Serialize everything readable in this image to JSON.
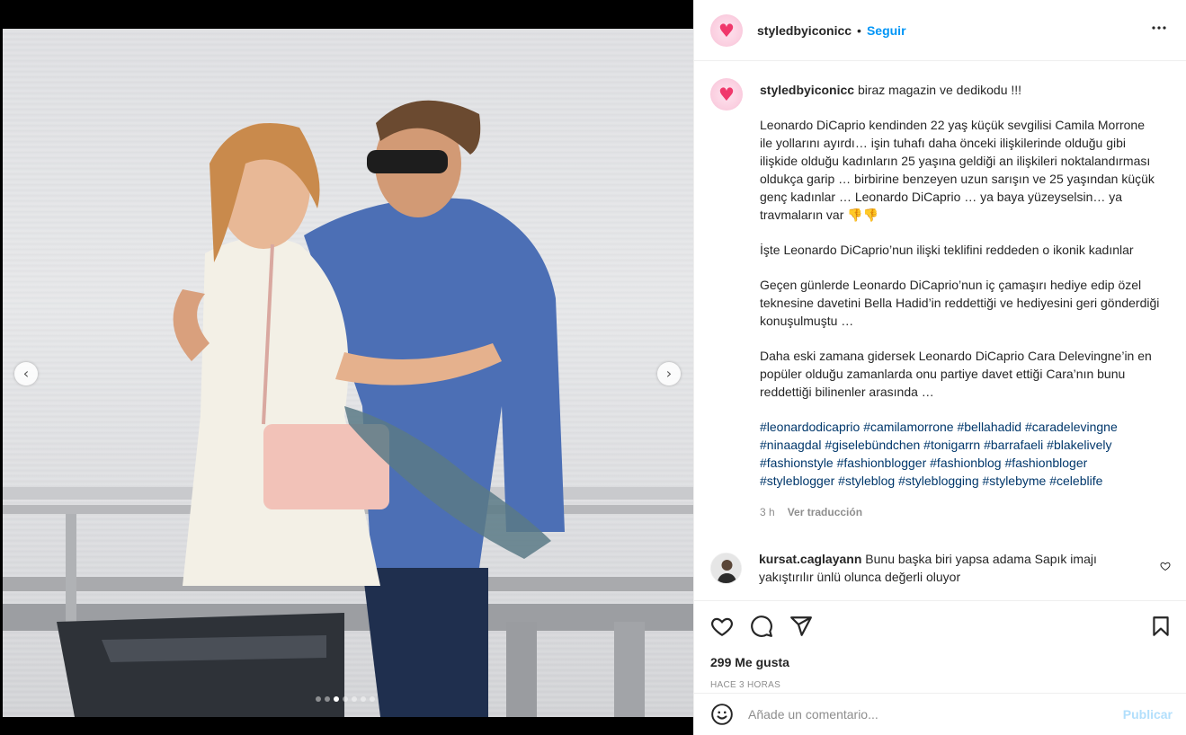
{
  "post": {
    "author": "styledbyiconicc",
    "separator": "•",
    "follow_label": "Seguir",
    "more_label": "•••"
  },
  "caption": {
    "username": "styledbyiconicc",
    "intro": "biraz magazin ve dedikodu !!!",
    "paragraph1": "Leonardo DiCaprio kendinden 22 yaş küçük sevgilisi Camila Morrone ile yollarını ayırdı… işin tuhafı daha önceki ilişkilerinde olduğu gibi ilişkide olduğu kadınların 25 yaşına geldiği an ilişkileri noktalandırması oldukça garip … birbirine benzeyen uzun sarışın ve 25 yaşından küçük genç kadınlar … Leonardo DiCaprio … ya baya yüzeyselsin… ya travmaların var 👎👎",
    "paragraph2": "İşte Leonardo DiCaprio’nun ilişki teklifini reddeden o ikonik kadınlar",
    "paragraph3": "Geçen günlerde Leonardo DiCaprio’nun iç çamaşırı hediye edip özel teknesine davetini Bella Hadid’in reddettiği ve hediyesini geri gönderdiği konuşulmuştu …",
    "paragraph4": "Daha eski zamana gidersek Leonardo DiCaprio Cara Delevingne’in en popüler olduğu zamanlarda onu partiye davet ettiği Cara’nın bunu reddettiği bilinenler arasında …",
    "hashtags": [
      "#leonardodicaprio",
      "#camilamorrone",
      "#bellahadid",
      "#caradelevingne",
      "#ninaagdal",
      "#giselebündchen",
      "#tonigarrn",
      "#barrafaeli",
      "#blakelively",
      "#fashionstyle",
      "#fashionblogger",
      "#fashionblog",
      "#fashionbloger",
      "#styleblogger",
      "#styleblog",
      "#styleblogging",
      "#stylebyme",
      "#celeblife"
    ],
    "age": "3 h",
    "translate_label": "Ver traducción"
  },
  "comment": {
    "username": "kursat.caglayann",
    "text": "Bunu başka biri yapsa adama Sapık imajı yakıştırılır ünlü olunca değerli oluyor"
  },
  "engagement": {
    "likes": "299 Me gusta",
    "time_ago": "HACE 3 HORAS"
  },
  "add_comment": {
    "placeholder": "Añade un comentario...",
    "publish_label": "Publicar"
  },
  "carousel": {
    "prev_icon": "‹",
    "next_icon": "›",
    "slide_count": 7,
    "active_slide": 2
  },
  "icons": {
    "heart": "heart-icon",
    "comment": "comment-icon",
    "share": "share-icon",
    "save": "bookmark-icon",
    "emoji": "emoji-icon",
    "more": "more-options-icon"
  },
  "colors": {
    "accent_blue": "#0095f6",
    "hashtag": "#00376b",
    "publish_disabled": "#b2dffc",
    "secondary_text": "#8e8e8e"
  }
}
